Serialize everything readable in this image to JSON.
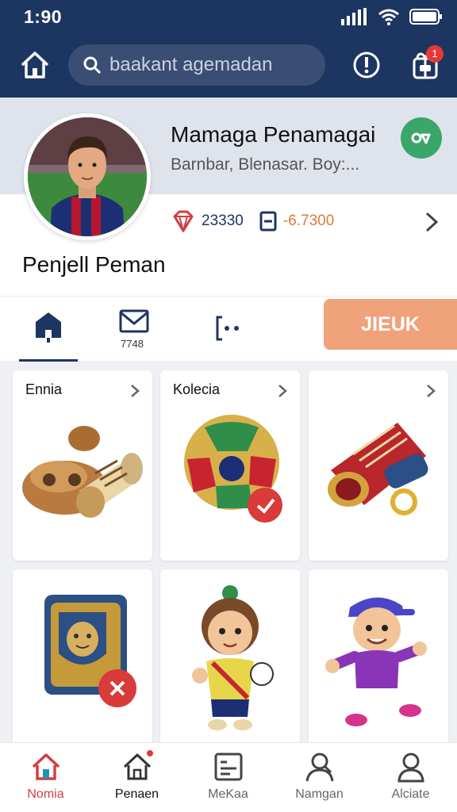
{
  "status": {
    "time": "1:90"
  },
  "header": {
    "search_placeholder": "baakant agemadan",
    "notif_count": "1"
  },
  "profile": {
    "title": "Mamaga Penamagai",
    "subtitle": "Barnbar, Blenasar. Boy:...",
    "stat1": "23330",
    "stat2": "-6.7300",
    "user_name": "Penjell Peman"
  },
  "tabs": [
    {
      "name": "home",
      "label": ""
    },
    {
      "name": "messages",
      "label": "7748"
    },
    {
      "name": "share",
      "label": ""
    }
  ],
  "action_button": "JIEUK",
  "cards": [
    {
      "title": "Ennia",
      "item": "wooden-items"
    },
    {
      "title": "Kolecia",
      "item": "ball"
    },
    {
      "title": "",
      "item": "boot"
    },
    {
      "title": "",
      "item": "shield-card"
    },
    {
      "title": "",
      "item": "figure-girl"
    },
    {
      "title": "",
      "item": "figure-boy"
    }
  ],
  "bottom_nav": [
    {
      "label": "Nomia",
      "icon": "home-icon"
    },
    {
      "label": "Penaen",
      "icon": "home-outline-icon"
    },
    {
      "label": "MeKaa",
      "icon": "list-icon"
    },
    {
      "label": "Namgan",
      "icon": "person-icon"
    },
    {
      "label": "Alciate",
      "icon": "profile-icon"
    }
  ],
  "colors": {
    "header": "#1d3561",
    "accent": "#f0a27a",
    "active": "#d33d3d",
    "green": "#3aa66a"
  }
}
